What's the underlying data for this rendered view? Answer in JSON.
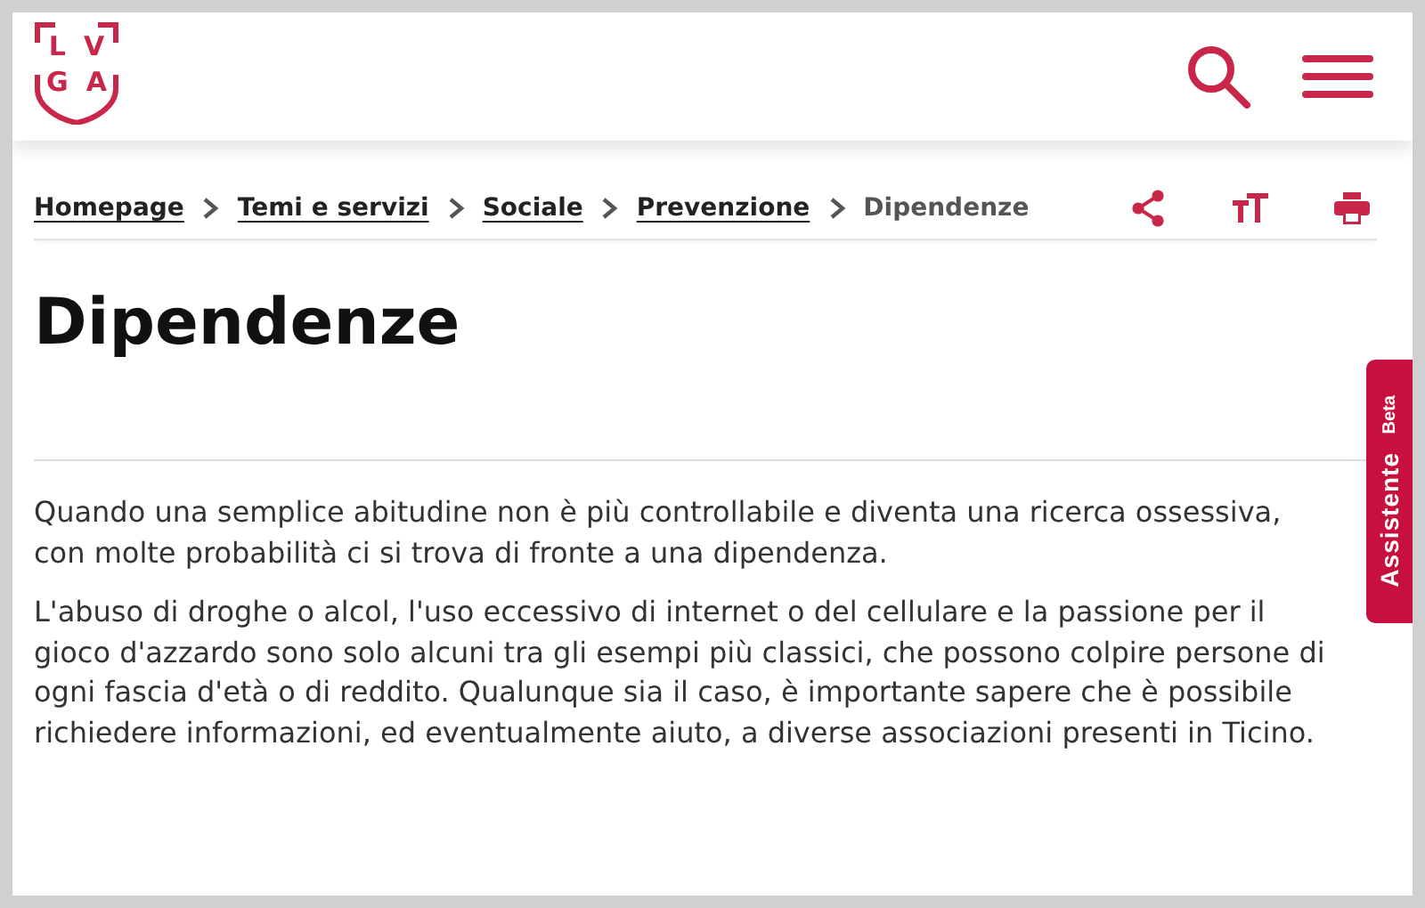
{
  "logo": {
    "letters_top": [
      "L",
      "V"
    ],
    "letters_bottom": [
      "G",
      "A"
    ]
  },
  "breadcrumb": [
    {
      "label": "Homepage",
      "current": false
    },
    {
      "label": "Temi e servizi",
      "current": false
    },
    {
      "label": "Sociale",
      "current": false
    },
    {
      "label": "Prevenzione",
      "current": false
    },
    {
      "label": "Dipendenze",
      "current": true
    }
  ],
  "page_title": "Dipendenze",
  "paragraphs": [
    "Quando una semplice abitudine non è più controllabile e diventa una ricerca ossessiva, con molte probabilità ci si trova di fronte a una dipendenza.",
    "L'abuso di droghe o alcol, l'uso eccessivo di internet o del cellulare e la passione per il gioco d'azzardo sono solo alcuni tra gli esempi più classici, che possono colpire persone di ogni fascia d'età o di reddito. Qualunque sia il caso, è importante sapere che è possibile richiedere informazioni, ed eventualmente aiuto, a diverse associazioni presenti in Ticino."
  ],
  "assistant_tab": {
    "label": "Assistente",
    "badge": "Beta"
  }
}
